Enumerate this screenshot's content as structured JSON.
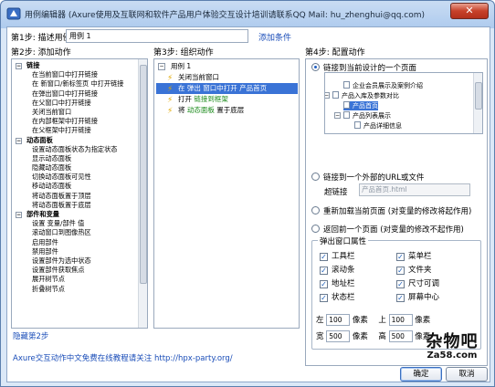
{
  "window": {
    "title": "用例编辑器 (Axure使用及互联网和软件产品用户体验交互设计培训请联系QQ Mail: hu_zhenghui@qq.com)",
    "close_label": "✕"
  },
  "step1": {
    "label": "第1步: 描述用例",
    "value": "用例 1",
    "add_condition": "添加条件"
  },
  "step2": {
    "label": "第2步: 添加动作",
    "groups": [
      {
        "title": "链接",
        "items": [
          "在当前窗口中打开链接",
          "在 新窗口/新标签页 中打开链接",
          "在弹出窗口中打开链接",
          "在父窗口中打开链接",
          "关闭当前窗口",
          "在内部框架中打开链接",
          "在父框架中打开链接"
        ]
      },
      {
        "title": "动态面板",
        "items": [
          "设置动态面板状态为指定状态",
          "显示动态面板",
          "隐藏动态面板",
          "切换动态面板可见性",
          "移动动态面板",
          "将动态面板置于顶层",
          "将动态面板置于底层"
        ]
      },
      {
        "title": "部件和变量",
        "items": [
          "设置 变量/部件 值",
          "滚动窗口到图像热区",
          "启用部件",
          "禁用部件",
          "设置部件为选中状态",
          "设置部件获取焦点",
          "展开树节点",
          "折叠树节点"
        ]
      }
    ],
    "hide_link": "隐藏第2步"
  },
  "step3": {
    "label": "第3步: 组织动作",
    "root": "用例 1",
    "actions": [
      {
        "prefix": "关闭当前窗口",
        "highlight": "",
        "suffix": "",
        "selected": false
      },
      {
        "prefix": "在 弹出 窗口中打开 产品首页",
        "highlight": "",
        "suffix": "",
        "selected": true
      },
      {
        "prefix": "打开 ",
        "highlight": "链接到框架",
        "suffix": "",
        "selected": false
      },
      {
        "prefix": "将 ",
        "highlight": "动态面板",
        "suffix": " 置于底层",
        "selected": false
      }
    ]
  },
  "step4": {
    "label": "第4步: 配置动作",
    "opt_current": "链接到当前设计的一个页面",
    "pages": [
      {
        "label": "企业会员展示及案例介绍",
        "level": 2,
        "selected": false
      },
      {
        "label": "产品入库及参数对比",
        "level": 1,
        "selected": false
      },
      {
        "label": "产品首页",
        "level": 2,
        "selected": true
      },
      {
        "label": "产品列表展示",
        "level": 2,
        "selected": false
      },
      {
        "label": "产品详细信息",
        "level": 3,
        "selected": false
      }
    ],
    "opt_external": "链接到一个外部的URL或文件",
    "hyperlink_label": "超链接",
    "hyperlink_value": "产品首页.html",
    "opt_reload": "重新加载当前页面 (对变量的修改将起作用)",
    "opt_back": "返回前一个页面 (对变量的修改不起作用)",
    "popup": {
      "title": "弹出窗口属性",
      "checkboxes": [
        {
          "label": "工具栏",
          "checked": true
        },
        {
          "label": "菜单栏",
          "checked": true
        },
        {
          "label": "滚动条",
          "checked": true
        },
        {
          "label": "文件夹",
          "checked": true
        },
        {
          "label": "地址栏",
          "checked": true
        },
        {
          "label": "尺寸可调",
          "checked": true
        },
        {
          "label": "状态栏",
          "checked": true
        },
        {
          "label": "屏幕中心",
          "checked": true
        }
      ],
      "left_label": "左",
      "left_value": "100",
      "top_label": "上",
      "top_value": "100",
      "width_label": "宽",
      "width_value": "500",
      "height_label": "高",
      "height_value": "500",
      "unit": "像素"
    }
  },
  "footer": {
    "text": "Axure交互动作中文免费在线教程请关注 http://hpx-party.org/",
    "ok": "确定",
    "cancel": "取消"
  },
  "watermark": {
    "cn": "杂物吧",
    "en": "Za58.com"
  }
}
